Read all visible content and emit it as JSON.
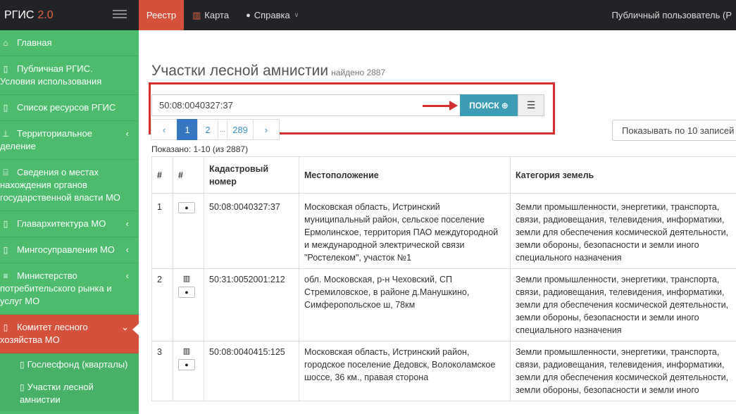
{
  "topbar": {
    "brand": "РГИС",
    "version": "2.0",
    "nav": [
      {
        "label": "Реестр",
        "icon": "",
        "active": true
      },
      {
        "label": "Карта",
        "icon": "map-icon"
      },
      {
        "label": "Справка",
        "icon": "help-icon"
      }
    ],
    "user": "Публичный пользователь (Р"
  },
  "sidebar": {
    "items": [
      {
        "label": "Главная",
        "icon": "home-icon"
      },
      {
        "label": "Публичная РГИС. Условия использования",
        "icon": "doc-icon"
      },
      {
        "label": "Список ресурсов РГИС",
        "icon": "doc-icon"
      },
      {
        "label": "Территориальное деление",
        "icon": "pin-icon",
        "chevron": "‹"
      },
      {
        "label": "Сведения о местах нахождения органов государственной власти МО",
        "icon": "bank-icon"
      },
      {
        "label": "Главархитектура МО",
        "icon": "doc-icon",
        "chevron": "‹"
      },
      {
        "label": "Мингосуправления МО",
        "icon": "doc-icon",
        "chevron": "‹"
      },
      {
        "label": "Министерство потребительского рынка и услуг МО",
        "icon": "list-icon",
        "chevron": "‹"
      },
      {
        "label": "Комитет лесного хозяйства МО",
        "icon": "doc-icon",
        "chevron": "⌄",
        "active": true
      }
    ],
    "subitems": [
      {
        "label": "Гослесфонд (кварталы)",
        "icon": "doc-icon"
      },
      {
        "label": "Участки лесной амнистии",
        "icon": "doc-icon"
      }
    ]
  },
  "main": {
    "title": "Участки лесной амнистии",
    "found": "найдено 2887",
    "search": {
      "value": "50:08:0040327:37",
      "button": "ПОИСК"
    },
    "pagination": [
      "‹",
      "1",
      "2",
      "...",
      "289",
      "›"
    ],
    "per_page": "Показывать по 10 записей",
    "shown": "Показано: 1-10 (из 2887)",
    "columns": [
      "#",
      "#",
      "Кадастровый номер",
      "Местоположение",
      "Категория земель"
    ],
    "rows": [
      {
        "n": "1",
        "has_map": false,
        "cadastral": "50:08:0040327:37",
        "location": "Московская область, Истринский муниципальный район, сельское поселение Ермолинское, территория ПАО междугородной и международной электрической связи \"Ростелеком\", участок №1",
        "category": [
          "Земли промышленности, энергетики, транспорта,",
          "связи, радиовещания, телевидения, информатики,",
          "земли для обеспечения космической деятельности,",
          "земли обороны, безопасности и земли иного",
          "специального назначения"
        ]
      },
      {
        "n": "2",
        "has_map": true,
        "cadastral": "50:31:0052001:212",
        "location": "обл. Московская, р-н Чеховский, СП Стремиловское, в районе д.Манушкино, Симферопольское ш, 78км",
        "category": [
          "Земли промышленности, энергетики, транспорта,",
          "связи, радиовещания, телевидения, информатики,",
          "земли для обеспечения космической деятельности,",
          "земли обороны, безопасности и земли иного",
          "специального назначения"
        ]
      },
      {
        "n": "3",
        "has_map": true,
        "cadastral": "50:08:0040415:125",
        "location": "Московская область, Истринский район, городское поселение Дедовск, Волоколамское шоссе, 36 км., правая сторона",
        "category": [
          "Земли промышленности, энергетики, транспорта,",
          "связи, радиовещания, телевидения, информатики,",
          "земли для обеспечения космической деятельности,",
          "земли обороны, безопасности и земли иного"
        ]
      }
    ]
  },
  "colors": {
    "accent_red": "#d6513c",
    "sidebar_green": "#4cbb6c",
    "search_blue": "#3d9db5",
    "highlight": "#d32f2f"
  }
}
